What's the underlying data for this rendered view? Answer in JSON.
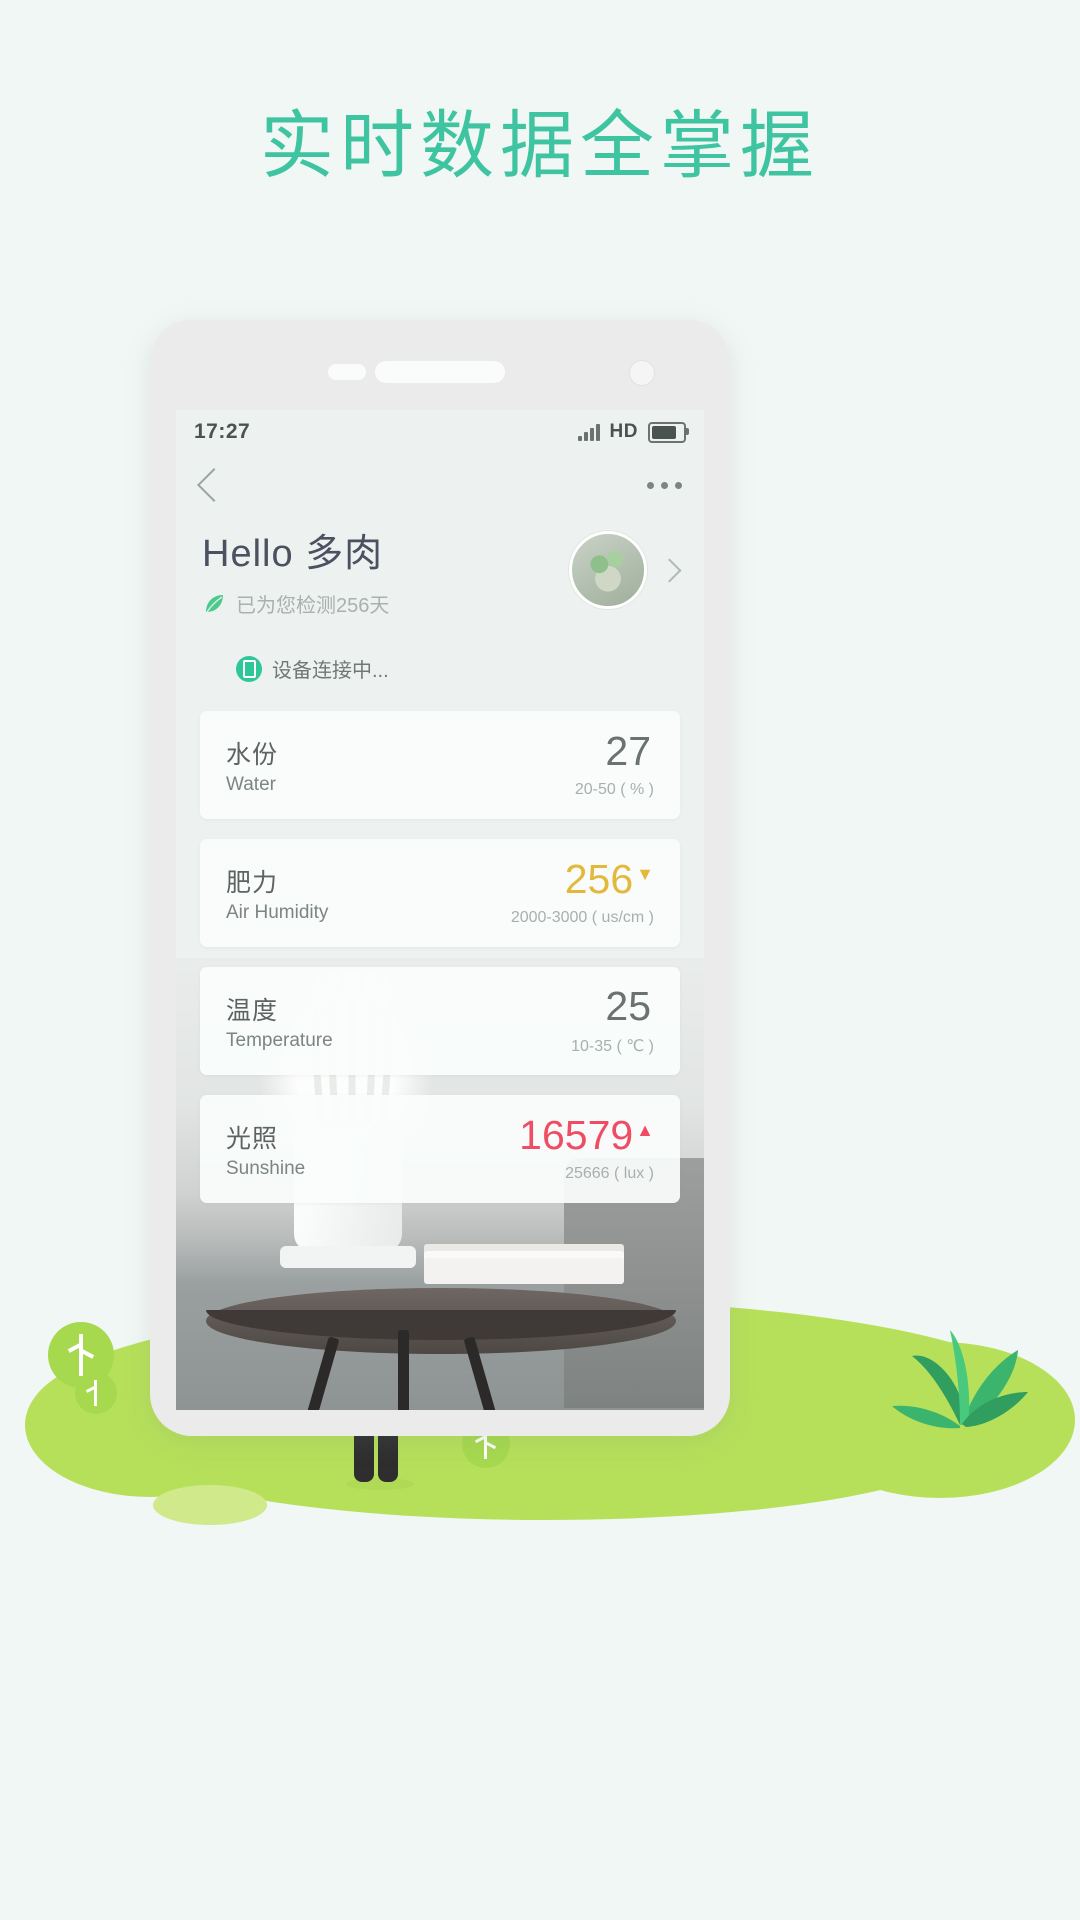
{
  "page": {
    "headline": "实时数据全掌握",
    "accent_color": "#3ec4a0",
    "background_color": "#f1f7f4",
    "grass_color": "#b6e05a"
  },
  "phone": {
    "speaker_icon": "speaker-grille",
    "camera_icon": "front-camera",
    "sensor_icon": "proximity-sensor"
  },
  "status_bar": {
    "time": "17:27",
    "signal_icon": "signal-bars",
    "network_label": "HD",
    "battery_icon": "battery-full"
  },
  "nav": {
    "back_icon": "chevron-left-icon",
    "more_icon": "more-horizontal-icon"
  },
  "header": {
    "greeting": "Hello 多肉",
    "leaf_icon": "leaf-icon",
    "monitor_text": "已为您检测256天",
    "avatar_icon": "plant-avatar",
    "chevron_icon": "chevron-right-icon",
    "device_icon": "device-icon",
    "connection_text": "设备连接中..."
  },
  "cards": [
    {
      "name_cn": "水份",
      "name_en": "Water",
      "value": "27",
      "trend": "",
      "range": "20-50 ( % )",
      "state": "normal"
    },
    {
      "name_cn": "肥力",
      "name_en": "Air Humidity",
      "value": "256",
      "trend": "▼",
      "range": "2000-3000 ( us/cm )",
      "state": "warn"
    },
    {
      "name_cn": "温度",
      "name_en": "Temperature",
      "value": "25",
      "trend": "",
      "range": "10-35 ( ℃ )",
      "state": "normal"
    },
    {
      "name_cn": "光照",
      "name_en": "Sunshine",
      "value": "16579",
      "trend": "▲",
      "range": "25666 ( lux )",
      "state": "alert"
    }
  ],
  "illustration": {
    "person_icon": "person-with-phone",
    "succulent_icon": "succulent-plant",
    "tree_icons": [
      "small-tree",
      "small-tree",
      "small-tree"
    ],
    "pad_icon": "ground-pad"
  }
}
